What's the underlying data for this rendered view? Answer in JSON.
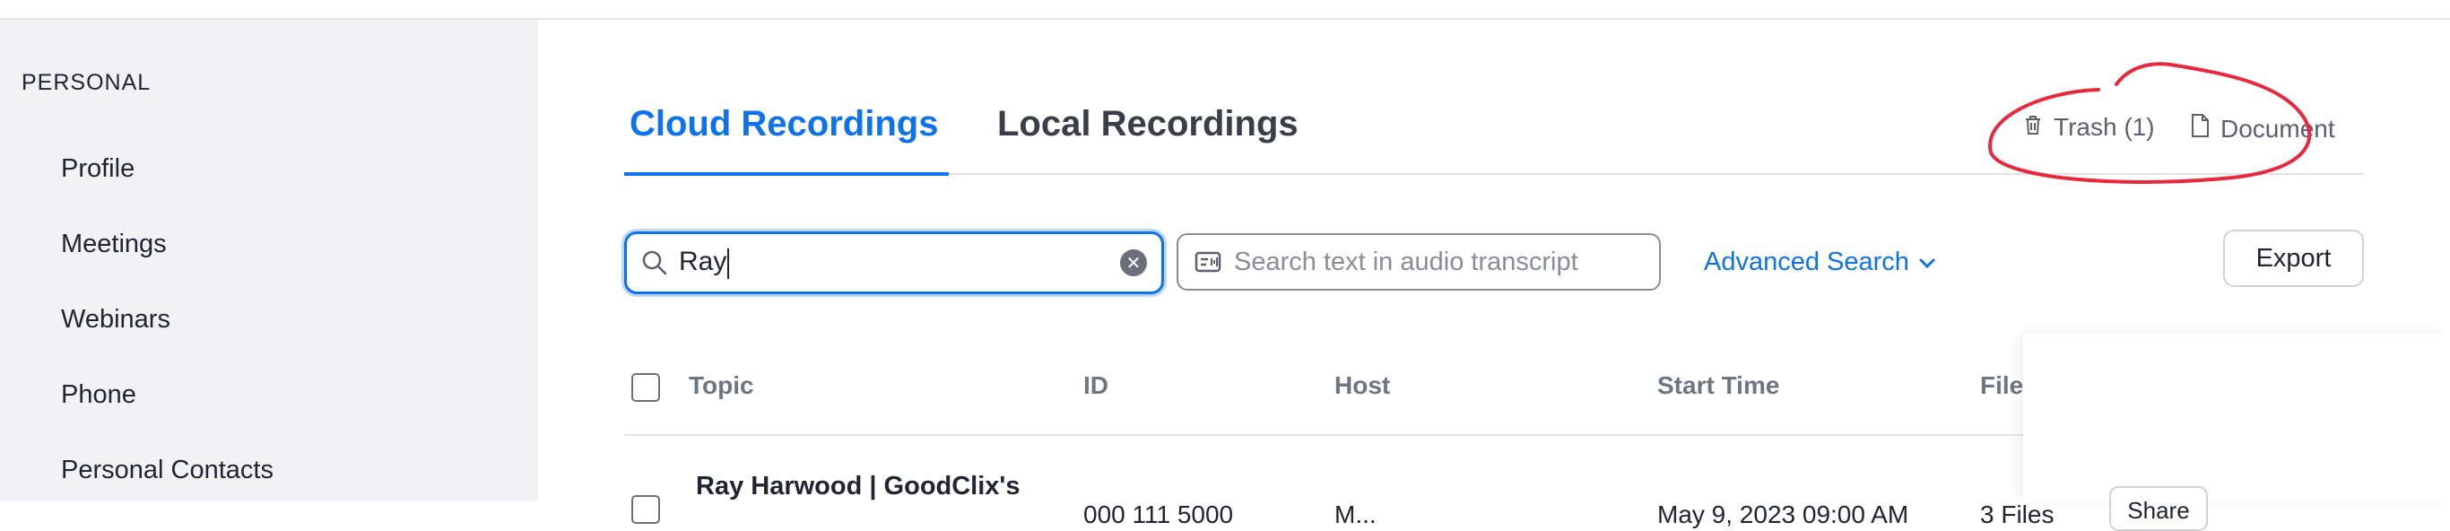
{
  "sidebar": {
    "section_title": "PERSONAL",
    "items": [
      {
        "label": "Profile"
      },
      {
        "label": "Meetings"
      },
      {
        "label": "Webinars"
      },
      {
        "label": "Phone"
      },
      {
        "label": "Personal Contacts"
      }
    ]
  },
  "tabs": [
    {
      "label": "Cloud Recordings",
      "active": true
    },
    {
      "label": "Local Recordings",
      "active": false
    }
  ],
  "header_links": {
    "trash": "Trash (1)",
    "document": "Document"
  },
  "search": {
    "value": "Ray",
    "transcript_placeholder": "Search text in audio transcript",
    "advanced_label": "Advanced Search",
    "export_label": "Export"
  },
  "table": {
    "columns": [
      "Topic",
      "ID",
      "Host",
      "Start Time",
      "File"
    ],
    "rows": [
      {
        "topic": "Ray Harwood | GoodClix's",
        "id": "000 111 5000",
        "host": "M...",
        "start_time": "May 9, 2023 09:00 AM",
        "files": "3 Files",
        "share": "Share"
      }
    ]
  },
  "colors": {
    "accent": "#0e72ed",
    "annotation": "#e8283c",
    "sidebar_bg": "#f2f2f5"
  }
}
